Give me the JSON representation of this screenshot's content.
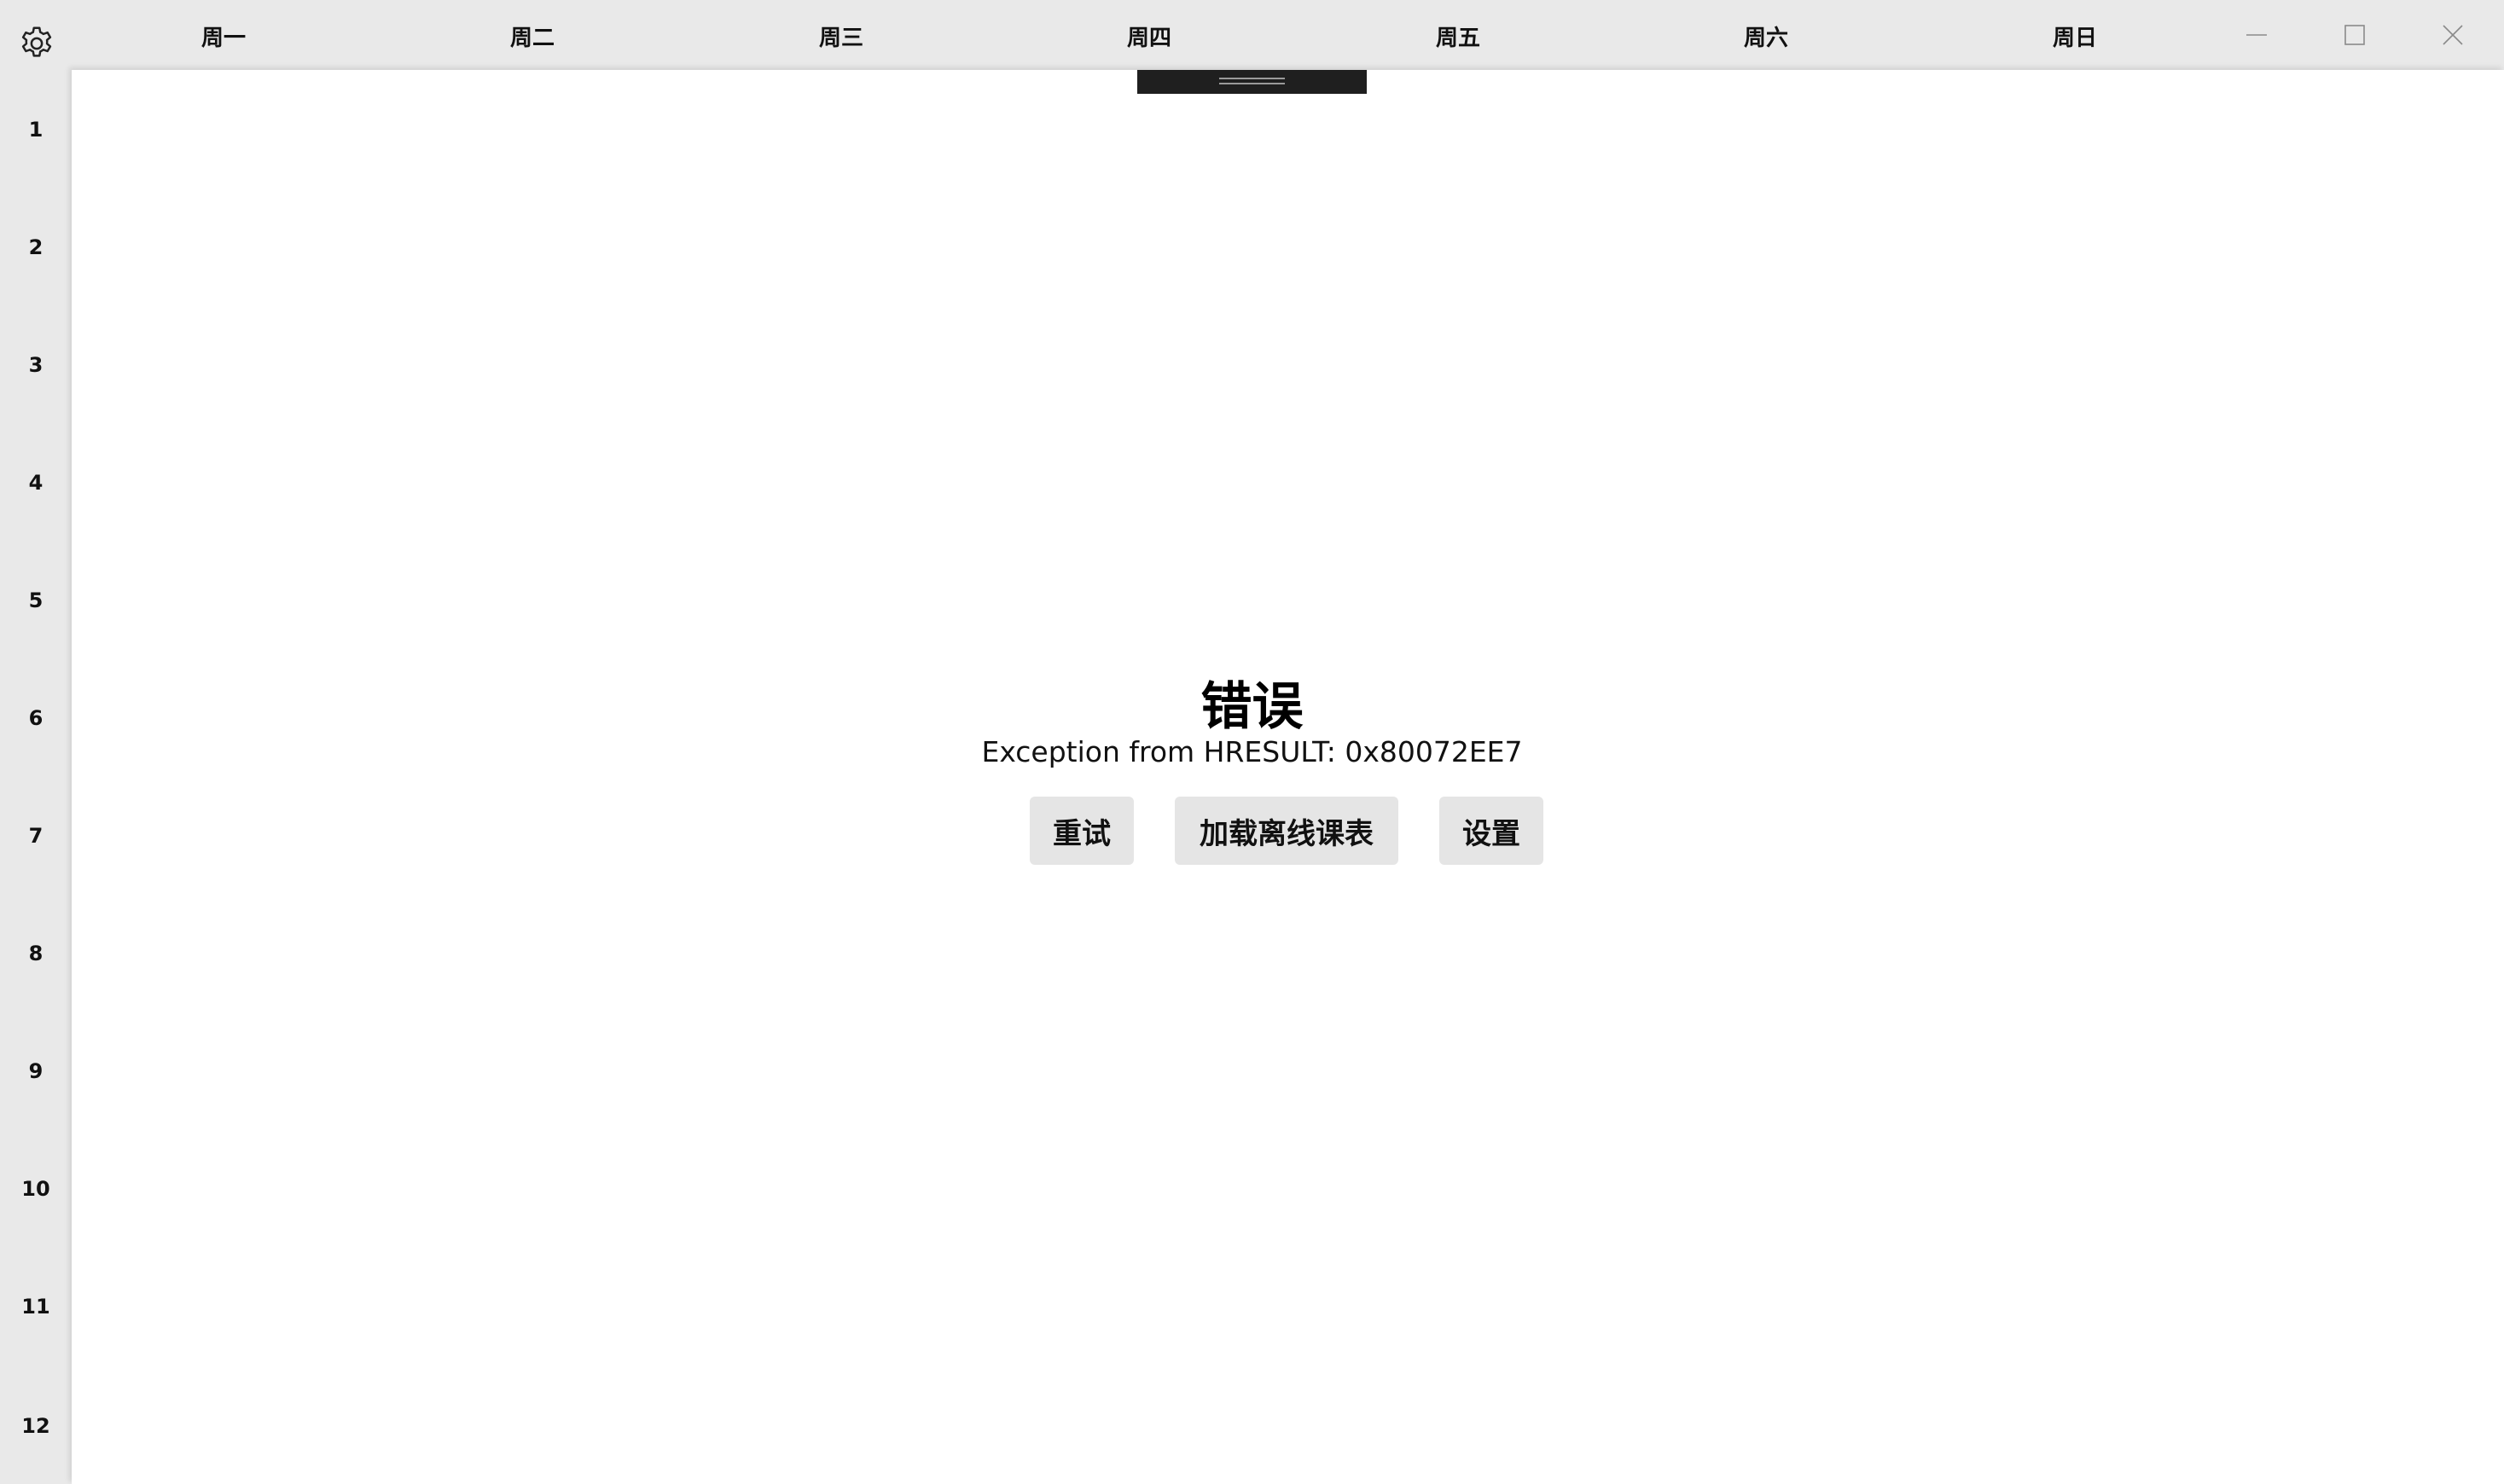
{
  "header": {
    "settings_icon": "gear-icon",
    "days": [
      "周一",
      "周二",
      "周三",
      "周四",
      "周五",
      "周六",
      "周日"
    ],
    "window_controls": [
      "minimize-icon",
      "maximize-icon",
      "close-icon"
    ]
  },
  "periods": [
    "1",
    "2",
    "3",
    "4",
    "5",
    "6",
    "7",
    "8",
    "9",
    "10",
    "11",
    "12"
  ],
  "error": {
    "title": "错误",
    "message": "Exception from HRESULT: 0x80072EE7"
  },
  "actions": {
    "retry_label": "重试",
    "load_offline_label": "加载离线课表",
    "settings_label": "设置"
  },
  "colors": {
    "chrome": "#e9e9e9",
    "panel": "#ffffff",
    "button": "#e5e5e5",
    "handle": "#1f1f1f"
  }
}
